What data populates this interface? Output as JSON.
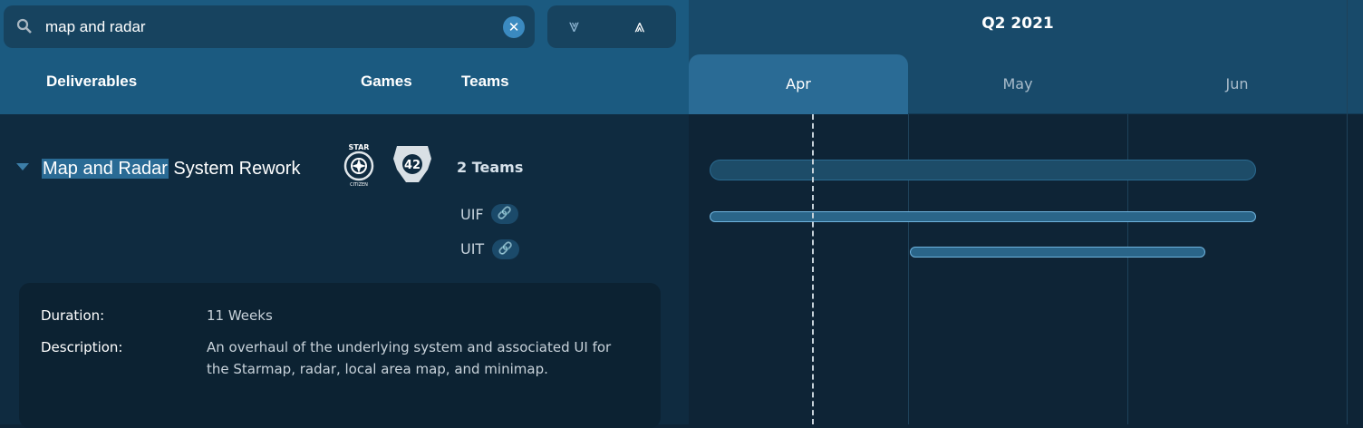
{
  "search": {
    "value": "map and radar",
    "clear_label": "✕"
  },
  "controls": {
    "expand_all": "⩔",
    "collapse_all": "⩓"
  },
  "columns": {
    "deliverables": "Deliverables",
    "games": "Games",
    "teams": "Teams"
  },
  "timeline": {
    "quarter": "Q2 2021",
    "months": [
      "Apr",
      "May",
      "Jun"
    ],
    "active_month": "Apr"
  },
  "deliverable": {
    "title_highlight": "Map and Radar",
    "title_rest": " System Rework",
    "games": [
      {
        "name": "Star Citizen",
        "logo_text": "STAR CITIZEN"
      },
      {
        "name": "Squadron 42",
        "logo_text": "42"
      }
    ],
    "teams_count": "2 Teams",
    "teams": [
      {
        "code": "UIF"
      },
      {
        "code": "UIT"
      }
    ],
    "duration_label": "Duration:",
    "duration": "11 Weeks",
    "description_label": "Description:",
    "description": "An overhaul of the underlying system and associated UI for the Starmap, radar, local area map, and minimap."
  },
  "colors": {
    "accent": "#2a6b95",
    "bar_border": "#6fb3dd"
  }
}
